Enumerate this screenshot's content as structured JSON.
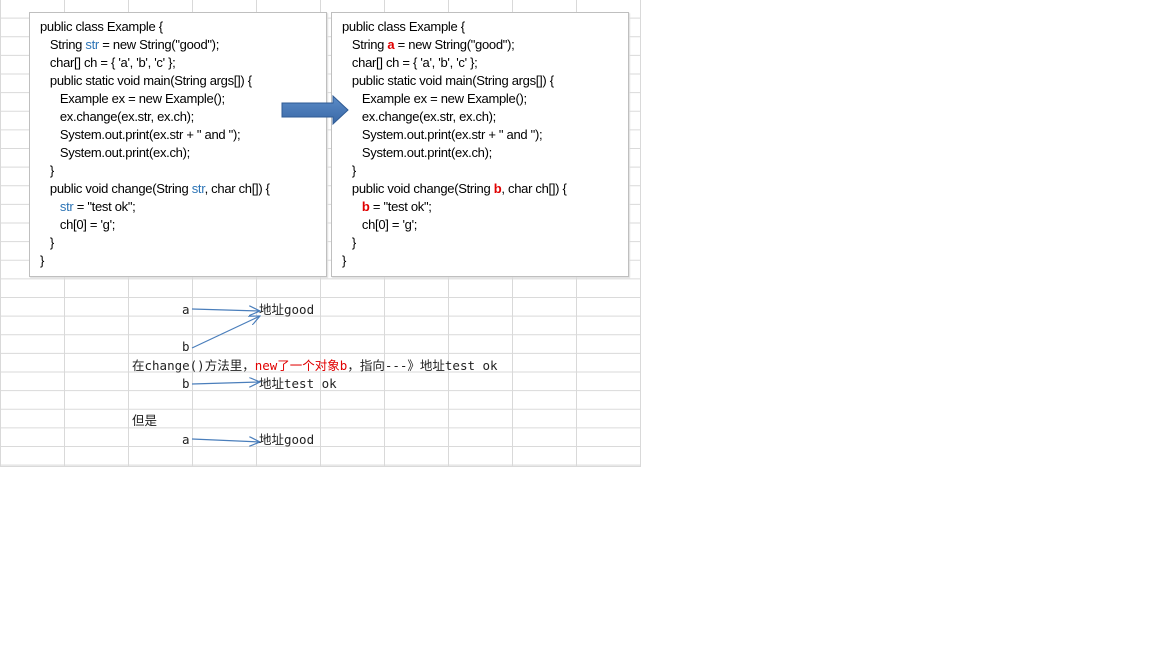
{
  "left_code": {
    "lines": [
      "public class Example {",
      "   String ",
      "str",
      " = new String(\"good\");",
      "   char[] ch = { 'a', 'b', 'c' };",
      "   public static void main(String args[]) {",
      "      Example ex = new Example();",
      "      ex.change(ex.str, ex.ch);",
      "      System.out.print(ex.str + \" and \");",
      "      System.out.print(ex.ch);",
      "   }",
      "   public void change(String ",
      "str",
      ", char ch[]) {",
      "      ",
      "str",
      " = \"test ok\";",
      "      ch[0] = 'g';",
      "   }",
      "}"
    ]
  },
  "right_code": {
    "lines": [
      "public class Example {",
      "   String ",
      "a",
      " = new String(\"good\");",
      "   char[] ch = { 'a', 'b', 'c' };",
      "   public static void main(String args[]) {",
      "      Example ex = new Example();",
      "      ex.change(ex.str, ex.ch);",
      "      System.out.print(ex.str + \" and \");",
      "      System.out.print(ex.ch);",
      "   }",
      "   public void change(String ",
      "b",
      ", char ch[]) {",
      "      ",
      "b",
      " = \"test ok\";",
      "      ch[0] = 'g';",
      "   }",
      "}"
    ]
  },
  "notes": {
    "a1": "a",
    "addr_good_1": "地址good",
    "b1": "b",
    "sentence_pre": "在change()方法里，",
    "sentence_red": "new了一个对象b",
    "sentence_post": "，指向---》地址test ok",
    "b2": "b",
    "addr_test_ok": "地址test ok",
    "but": "但是",
    "a2": "a",
    "addr_good_2": "地址good"
  },
  "colors": {
    "arrow": "#4a7ebb",
    "highlight_blue": "#2e75b6",
    "highlight_red": "#e00000"
  }
}
